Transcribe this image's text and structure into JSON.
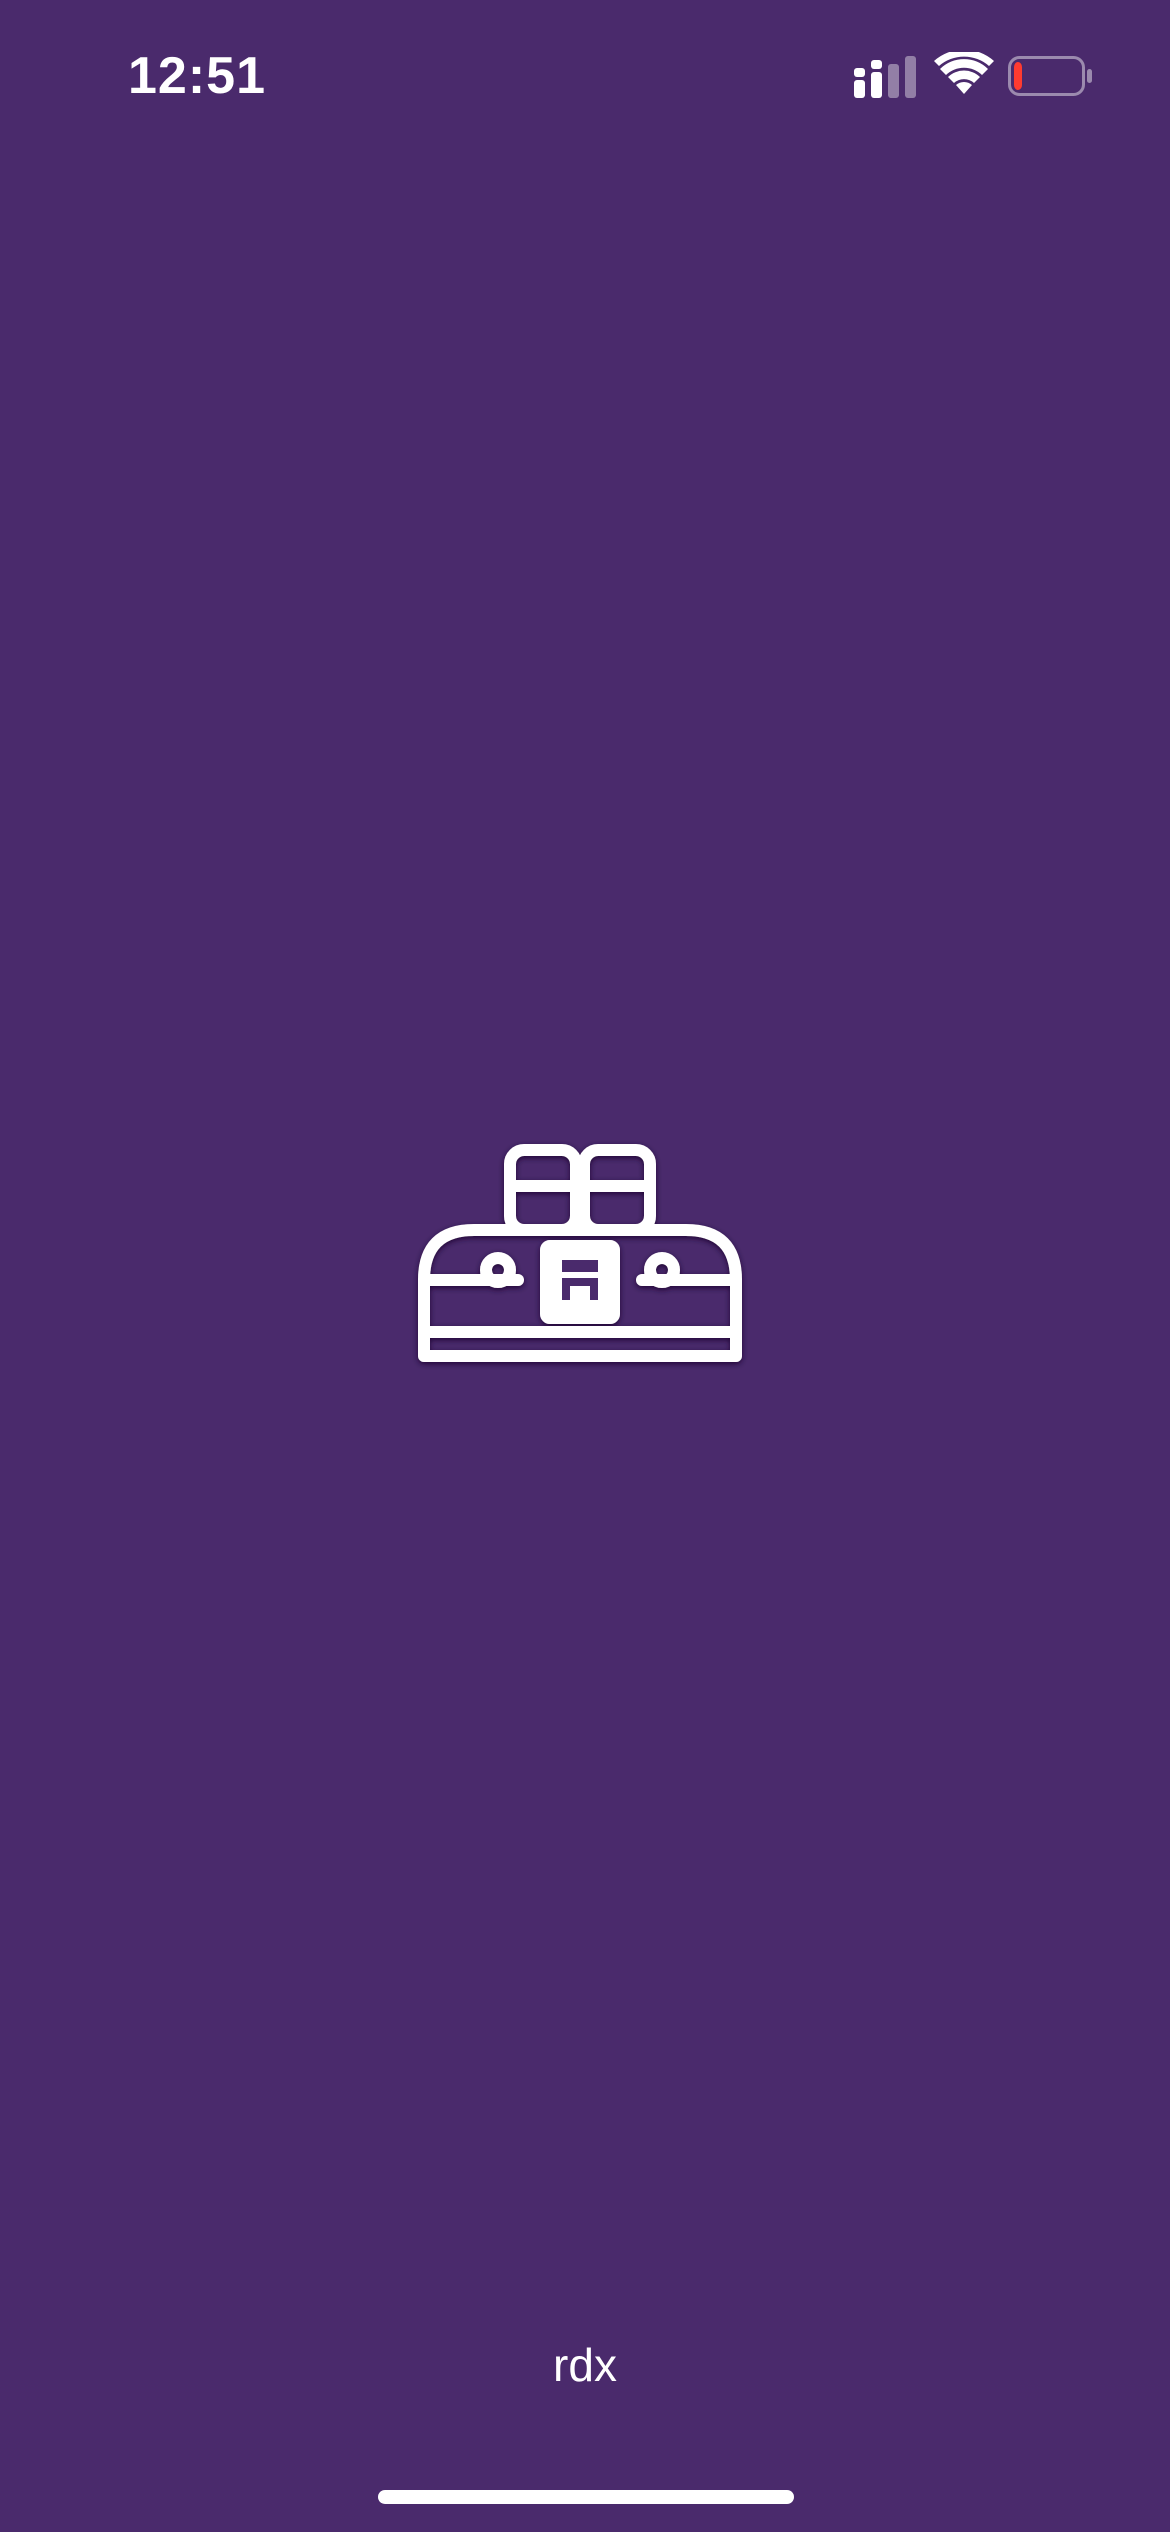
{
  "status_bar": {
    "time": "12:51",
    "signal_icon": "cellular-signal-icon",
    "wifi_icon": "wifi-icon",
    "battery_icon": "battery-low-icon",
    "battery_level": 0.12,
    "battery_low_color": "#ff3b30"
  },
  "splash": {
    "logo_icon": "toolbox-logo-icon",
    "app_name": "rdx"
  },
  "colors": {
    "background": "#4a2a6c",
    "foreground": "#ffffff"
  }
}
